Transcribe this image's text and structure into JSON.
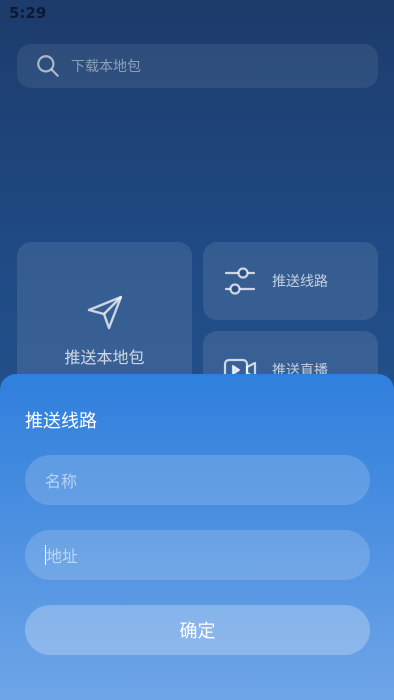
{
  "status_bar": {
    "time": "5:29"
  },
  "search": {
    "placeholder": "下载本地包",
    "icon": "search-icon"
  },
  "cards": {
    "push_local": {
      "label": "推送本地包",
      "icon": "send-icon"
    },
    "push_route": {
      "label": "推送线路",
      "icon": "sliders-icon"
    },
    "push_live": {
      "label": "推送直播",
      "icon": "video-icon"
    }
  },
  "sheet": {
    "title": "推送线路",
    "name_placeholder": "名称",
    "address_placeholder": "地址",
    "confirm_label": "确定"
  },
  "colors": {
    "background": "#1f4a84",
    "sheet_top": "#2f7fdd",
    "sheet_bottom": "#6fa5e8"
  }
}
